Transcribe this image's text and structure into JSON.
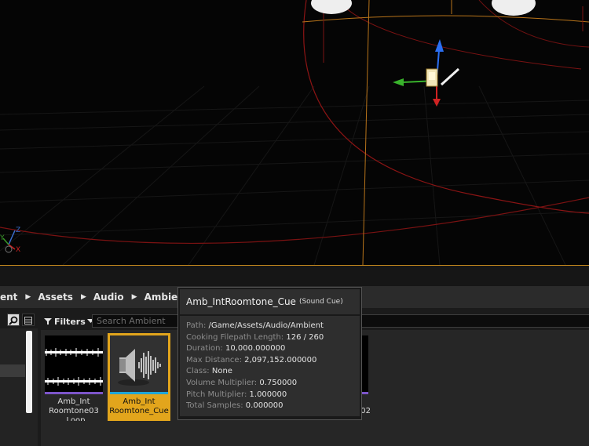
{
  "viewport": {
    "axis_labels": {
      "x": "X",
      "y": "Y",
      "z": "Z"
    }
  },
  "breadcrumb": {
    "items": [
      "ent",
      "Assets",
      "Audio",
      "Ambient"
    ],
    "separator": "▶"
  },
  "toolbar": {
    "filters_label": "Filters",
    "search_placeholder": "Search Ambient"
  },
  "assets": [
    {
      "label_line1": "Amb_Int",
      "label_line2": "Roomtone03",
      "label_line3": "_Loop",
      "selected": false,
      "type": "sound-wave"
    },
    {
      "label_line1": "Amb_Int",
      "label_line2": "Roomtone_Cue",
      "selected": true,
      "type": "sound-cue"
    },
    {
      "label_line1": "02",
      "selected": false,
      "type": "sound-wave",
      "partially_hidden": true
    }
  ],
  "tooltip": {
    "name": "Amb_IntRoomtone_Cue",
    "type": "(Sound Cue)",
    "rows": [
      {
        "key": "Path:",
        "value": "/Game/Assets/Audio/Ambient"
      },
      {
        "key": "Cooking Filepath Length:",
        "value": "126 / 260"
      },
      {
        "key": "Duration:",
        "value": "10,000.000000"
      },
      {
        "key": "Max Distance:",
        "value": "2,097,152.000000"
      },
      {
        "key": "Class:",
        "value": "None"
      },
      {
        "key": "Volume Multiplier:",
        "value": "0.750000"
      },
      {
        "key": "Pitch Multiplier:",
        "value": "1.000000"
      },
      {
        "key": "Total Samples:",
        "value": "0.000000"
      }
    ]
  },
  "colors": {
    "selection": "#e2a51c",
    "sound_wave_bar": "#7c55c9",
    "sound_cue_bar": "#1fa6d8",
    "viewport_border": "#c98a1c"
  }
}
